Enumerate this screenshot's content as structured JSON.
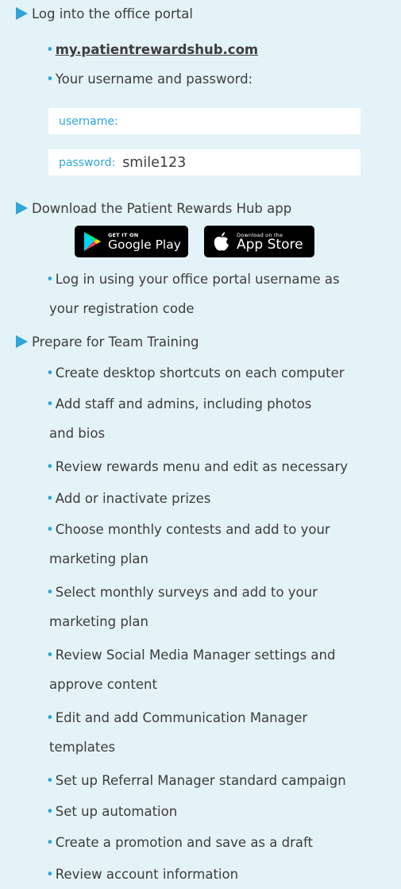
{
  "steps": [
    {
      "label": "Log into the office portal"
    },
    {
      "label": "Download the Patient Rewards Hub app"
    },
    {
      "label": "Prepare for Team Training"
    }
  ],
  "portal": {
    "url": "my.patientrewardshub.com",
    "credentials_label": "Your username and password:",
    "username_label": "username:",
    "username_value": "",
    "password_label": "password:",
    "password_value": "smile123"
  },
  "app": {
    "google_play_small": "GET IT ON",
    "google_play_big": "Google Play",
    "app_store_small": "Download on the",
    "app_store_big": "App Store",
    "login_line1": "Log in using your office portal username as",
    "login_line2": "your registration code"
  },
  "training": [
    [
      "Create desktop shortcuts on each computer"
    ],
    [
      "Add staff and admins, including photos",
      "and bios"
    ],
    [
      "Review rewards menu and edit as necessary"
    ],
    [
      "Add or inactivate prizes"
    ],
    [
      "Choose monthly contests and add to your",
      "marketing plan"
    ],
    [
      "Select monthly surveys and add to your",
      "marketing plan"
    ],
    [
      "Review Social Media Manager settings and",
      "approve content"
    ],
    [
      "Edit and add Communication Manager",
      "templates"
    ],
    [
      "Set up Referral Manager standard campaign"
    ],
    [
      "Set up automation"
    ],
    [
      "Create a promotion and save as a draft"
    ],
    [
      "Review account information"
    ]
  ],
  "colors": {
    "accent": "#2ea6d8",
    "background": "#e4f3f7",
    "text": "#3d3d3d"
  }
}
